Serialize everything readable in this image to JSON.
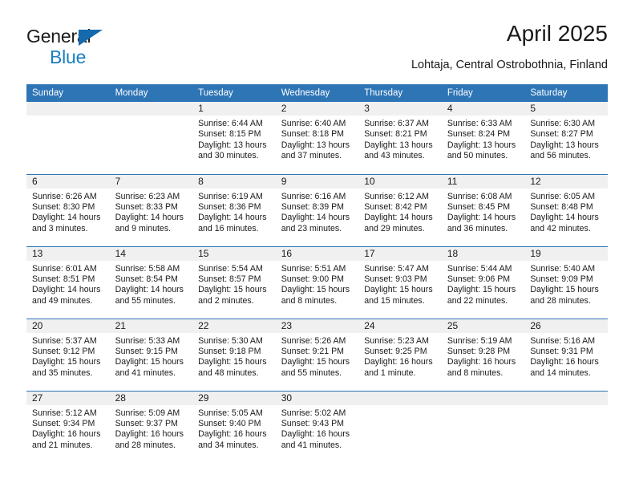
{
  "logo": {
    "word1": "General",
    "word2": "Blue",
    "triangle_color": "#156aae",
    "word2_color": "#1a7fc1"
  },
  "header": {
    "title": "April 2025",
    "subtitle": "Lohtaja, Central Ostrobothnia, Finland",
    "header_bg": "#2e75b6",
    "daynum_bg": "#f0f0f0"
  },
  "weekdays": [
    "Sunday",
    "Monday",
    "Tuesday",
    "Wednesday",
    "Thursday",
    "Friday",
    "Saturday"
  ],
  "weeks": [
    [
      {
        "day": "",
        "lines": []
      },
      {
        "day": "",
        "lines": []
      },
      {
        "day": "1",
        "lines": [
          "Sunrise: 6:44 AM",
          "Sunset: 8:15 PM",
          "Daylight: 13 hours",
          "and 30 minutes."
        ]
      },
      {
        "day": "2",
        "lines": [
          "Sunrise: 6:40 AM",
          "Sunset: 8:18 PM",
          "Daylight: 13 hours",
          "and 37 minutes."
        ]
      },
      {
        "day": "3",
        "lines": [
          "Sunrise: 6:37 AM",
          "Sunset: 8:21 PM",
          "Daylight: 13 hours",
          "and 43 minutes."
        ]
      },
      {
        "day": "4",
        "lines": [
          "Sunrise: 6:33 AM",
          "Sunset: 8:24 PM",
          "Daylight: 13 hours",
          "and 50 minutes."
        ]
      },
      {
        "day": "5",
        "lines": [
          "Sunrise: 6:30 AM",
          "Sunset: 8:27 PM",
          "Daylight: 13 hours",
          "and 56 minutes."
        ]
      }
    ],
    [
      {
        "day": "6",
        "lines": [
          "Sunrise: 6:26 AM",
          "Sunset: 8:30 PM",
          "Daylight: 14 hours",
          "and 3 minutes."
        ]
      },
      {
        "day": "7",
        "lines": [
          "Sunrise: 6:23 AM",
          "Sunset: 8:33 PM",
          "Daylight: 14 hours",
          "and 9 minutes."
        ]
      },
      {
        "day": "8",
        "lines": [
          "Sunrise: 6:19 AM",
          "Sunset: 8:36 PM",
          "Daylight: 14 hours",
          "and 16 minutes."
        ]
      },
      {
        "day": "9",
        "lines": [
          "Sunrise: 6:16 AM",
          "Sunset: 8:39 PM",
          "Daylight: 14 hours",
          "and 23 minutes."
        ]
      },
      {
        "day": "10",
        "lines": [
          "Sunrise: 6:12 AM",
          "Sunset: 8:42 PM",
          "Daylight: 14 hours",
          "and 29 minutes."
        ]
      },
      {
        "day": "11",
        "lines": [
          "Sunrise: 6:08 AM",
          "Sunset: 8:45 PM",
          "Daylight: 14 hours",
          "and 36 minutes."
        ]
      },
      {
        "day": "12",
        "lines": [
          "Sunrise: 6:05 AM",
          "Sunset: 8:48 PM",
          "Daylight: 14 hours",
          "and 42 minutes."
        ]
      }
    ],
    [
      {
        "day": "13",
        "lines": [
          "Sunrise: 6:01 AM",
          "Sunset: 8:51 PM",
          "Daylight: 14 hours",
          "and 49 minutes."
        ]
      },
      {
        "day": "14",
        "lines": [
          "Sunrise: 5:58 AM",
          "Sunset: 8:54 PM",
          "Daylight: 14 hours",
          "and 55 minutes."
        ]
      },
      {
        "day": "15",
        "lines": [
          "Sunrise: 5:54 AM",
          "Sunset: 8:57 PM",
          "Daylight: 15 hours",
          "and 2 minutes."
        ]
      },
      {
        "day": "16",
        "lines": [
          "Sunrise: 5:51 AM",
          "Sunset: 9:00 PM",
          "Daylight: 15 hours",
          "and 8 minutes."
        ]
      },
      {
        "day": "17",
        "lines": [
          "Sunrise: 5:47 AM",
          "Sunset: 9:03 PM",
          "Daylight: 15 hours",
          "and 15 minutes."
        ]
      },
      {
        "day": "18",
        "lines": [
          "Sunrise: 5:44 AM",
          "Sunset: 9:06 PM",
          "Daylight: 15 hours",
          "and 22 minutes."
        ]
      },
      {
        "day": "19",
        "lines": [
          "Sunrise: 5:40 AM",
          "Sunset: 9:09 PM",
          "Daylight: 15 hours",
          "and 28 minutes."
        ]
      }
    ],
    [
      {
        "day": "20",
        "lines": [
          "Sunrise: 5:37 AM",
          "Sunset: 9:12 PM",
          "Daylight: 15 hours",
          "and 35 minutes."
        ]
      },
      {
        "day": "21",
        "lines": [
          "Sunrise: 5:33 AM",
          "Sunset: 9:15 PM",
          "Daylight: 15 hours",
          "and 41 minutes."
        ]
      },
      {
        "day": "22",
        "lines": [
          "Sunrise: 5:30 AM",
          "Sunset: 9:18 PM",
          "Daylight: 15 hours",
          "and 48 minutes."
        ]
      },
      {
        "day": "23",
        "lines": [
          "Sunrise: 5:26 AM",
          "Sunset: 9:21 PM",
          "Daylight: 15 hours",
          "and 55 minutes."
        ]
      },
      {
        "day": "24",
        "lines": [
          "Sunrise: 5:23 AM",
          "Sunset: 9:25 PM",
          "Daylight: 16 hours",
          "and 1 minute."
        ]
      },
      {
        "day": "25",
        "lines": [
          "Sunrise: 5:19 AM",
          "Sunset: 9:28 PM",
          "Daylight: 16 hours",
          "and 8 minutes."
        ]
      },
      {
        "day": "26",
        "lines": [
          "Sunrise: 5:16 AM",
          "Sunset: 9:31 PM",
          "Daylight: 16 hours",
          "and 14 minutes."
        ]
      }
    ],
    [
      {
        "day": "27",
        "lines": [
          "Sunrise: 5:12 AM",
          "Sunset: 9:34 PM",
          "Daylight: 16 hours",
          "and 21 minutes."
        ]
      },
      {
        "day": "28",
        "lines": [
          "Sunrise: 5:09 AM",
          "Sunset: 9:37 PM",
          "Daylight: 16 hours",
          "and 28 minutes."
        ]
      },
      {
        "day": "29",
        "lines": [
          "Sunrise: 5:05 AM",
          "Sunset: 9:40 PM",
          "Daylight: 16 hours",
          "and 34 minutes."
        ]
      },
      {
        "day": "30",
        "lines": [
          "Sunrise: 5:02 AM",
          "Sunset: 9:43 PM",
          "Daylight: 16 hours",
          "and 41 minutes."
        ]
      },
      {
        "day": "",
        "lines": []
      },
      {
        "day": "",
        "lines": []
      },
      {
        "day": "",
        "lines": []
      }
    ]
  ]
}
